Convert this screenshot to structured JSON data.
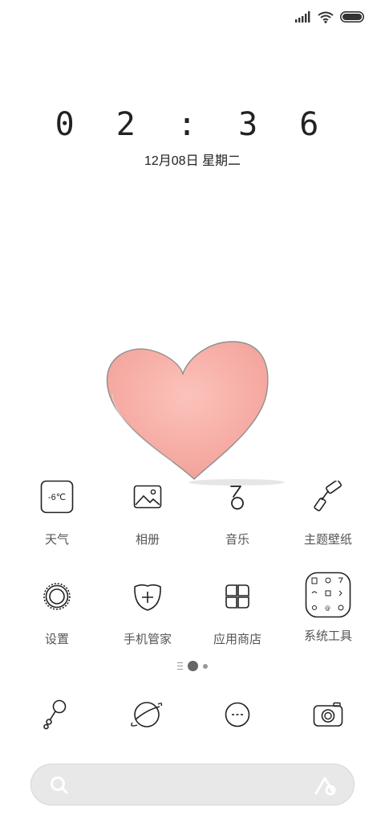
{
  "status_bar": {
    "signal_icon": "signal-icon",
    "wifi_icon": "wifi-icon",
    "battery_icon": "battery-icon",
    "battery_level": 1.0
  },
  "lock": {
    "time": "02:36",
    "time_display": "0 2 : 3 6",
    "date": "12月08日 星期二"
  },
  "wallpaper": {
    "subject": "heart-drawing",
    "heart_color": "#f6b0a8"
  },
  "apps": [
    {
      "label": "天气",
      "icon": "weather-icon",
      "icon_text": "-6℃"
    },
    {
      "label": "相册",
      "icon": "gallery-icon"
    },
    {
      "label": "音乐",
      "icon": "music-icon"
    },
    {
      "label": "主题壁纸",
      "icon": "theme-brush-icon"
    },
    {
      "label": "设置",
      "icon": "settings-gear-icon"
    },
    {
      "label": "手机管家",
      "icon": "security-shield-icon"
    },
    {
      "label": "应用商店",
      "icon": "app-store-grid-icon"
    },
    {
      "label": "系统工具",
      "icon": "system-tools-folder-icon"
    }
  ],
  "page_indicator": {
    "pages": 2,
    "current": 1
  },
  "dock": [
    {
      "icon": "phone-icon"
    },
    {
      "icon": "browser-planet-icon"
    },
    {
      "icon": "messages-icon"
    },
    {
      "icon": "camera-icon"
    }
  ],
  "search": {
    "search_icon": "search-icon",
    "assistant_icon": "assistant-icon"
  }
}
